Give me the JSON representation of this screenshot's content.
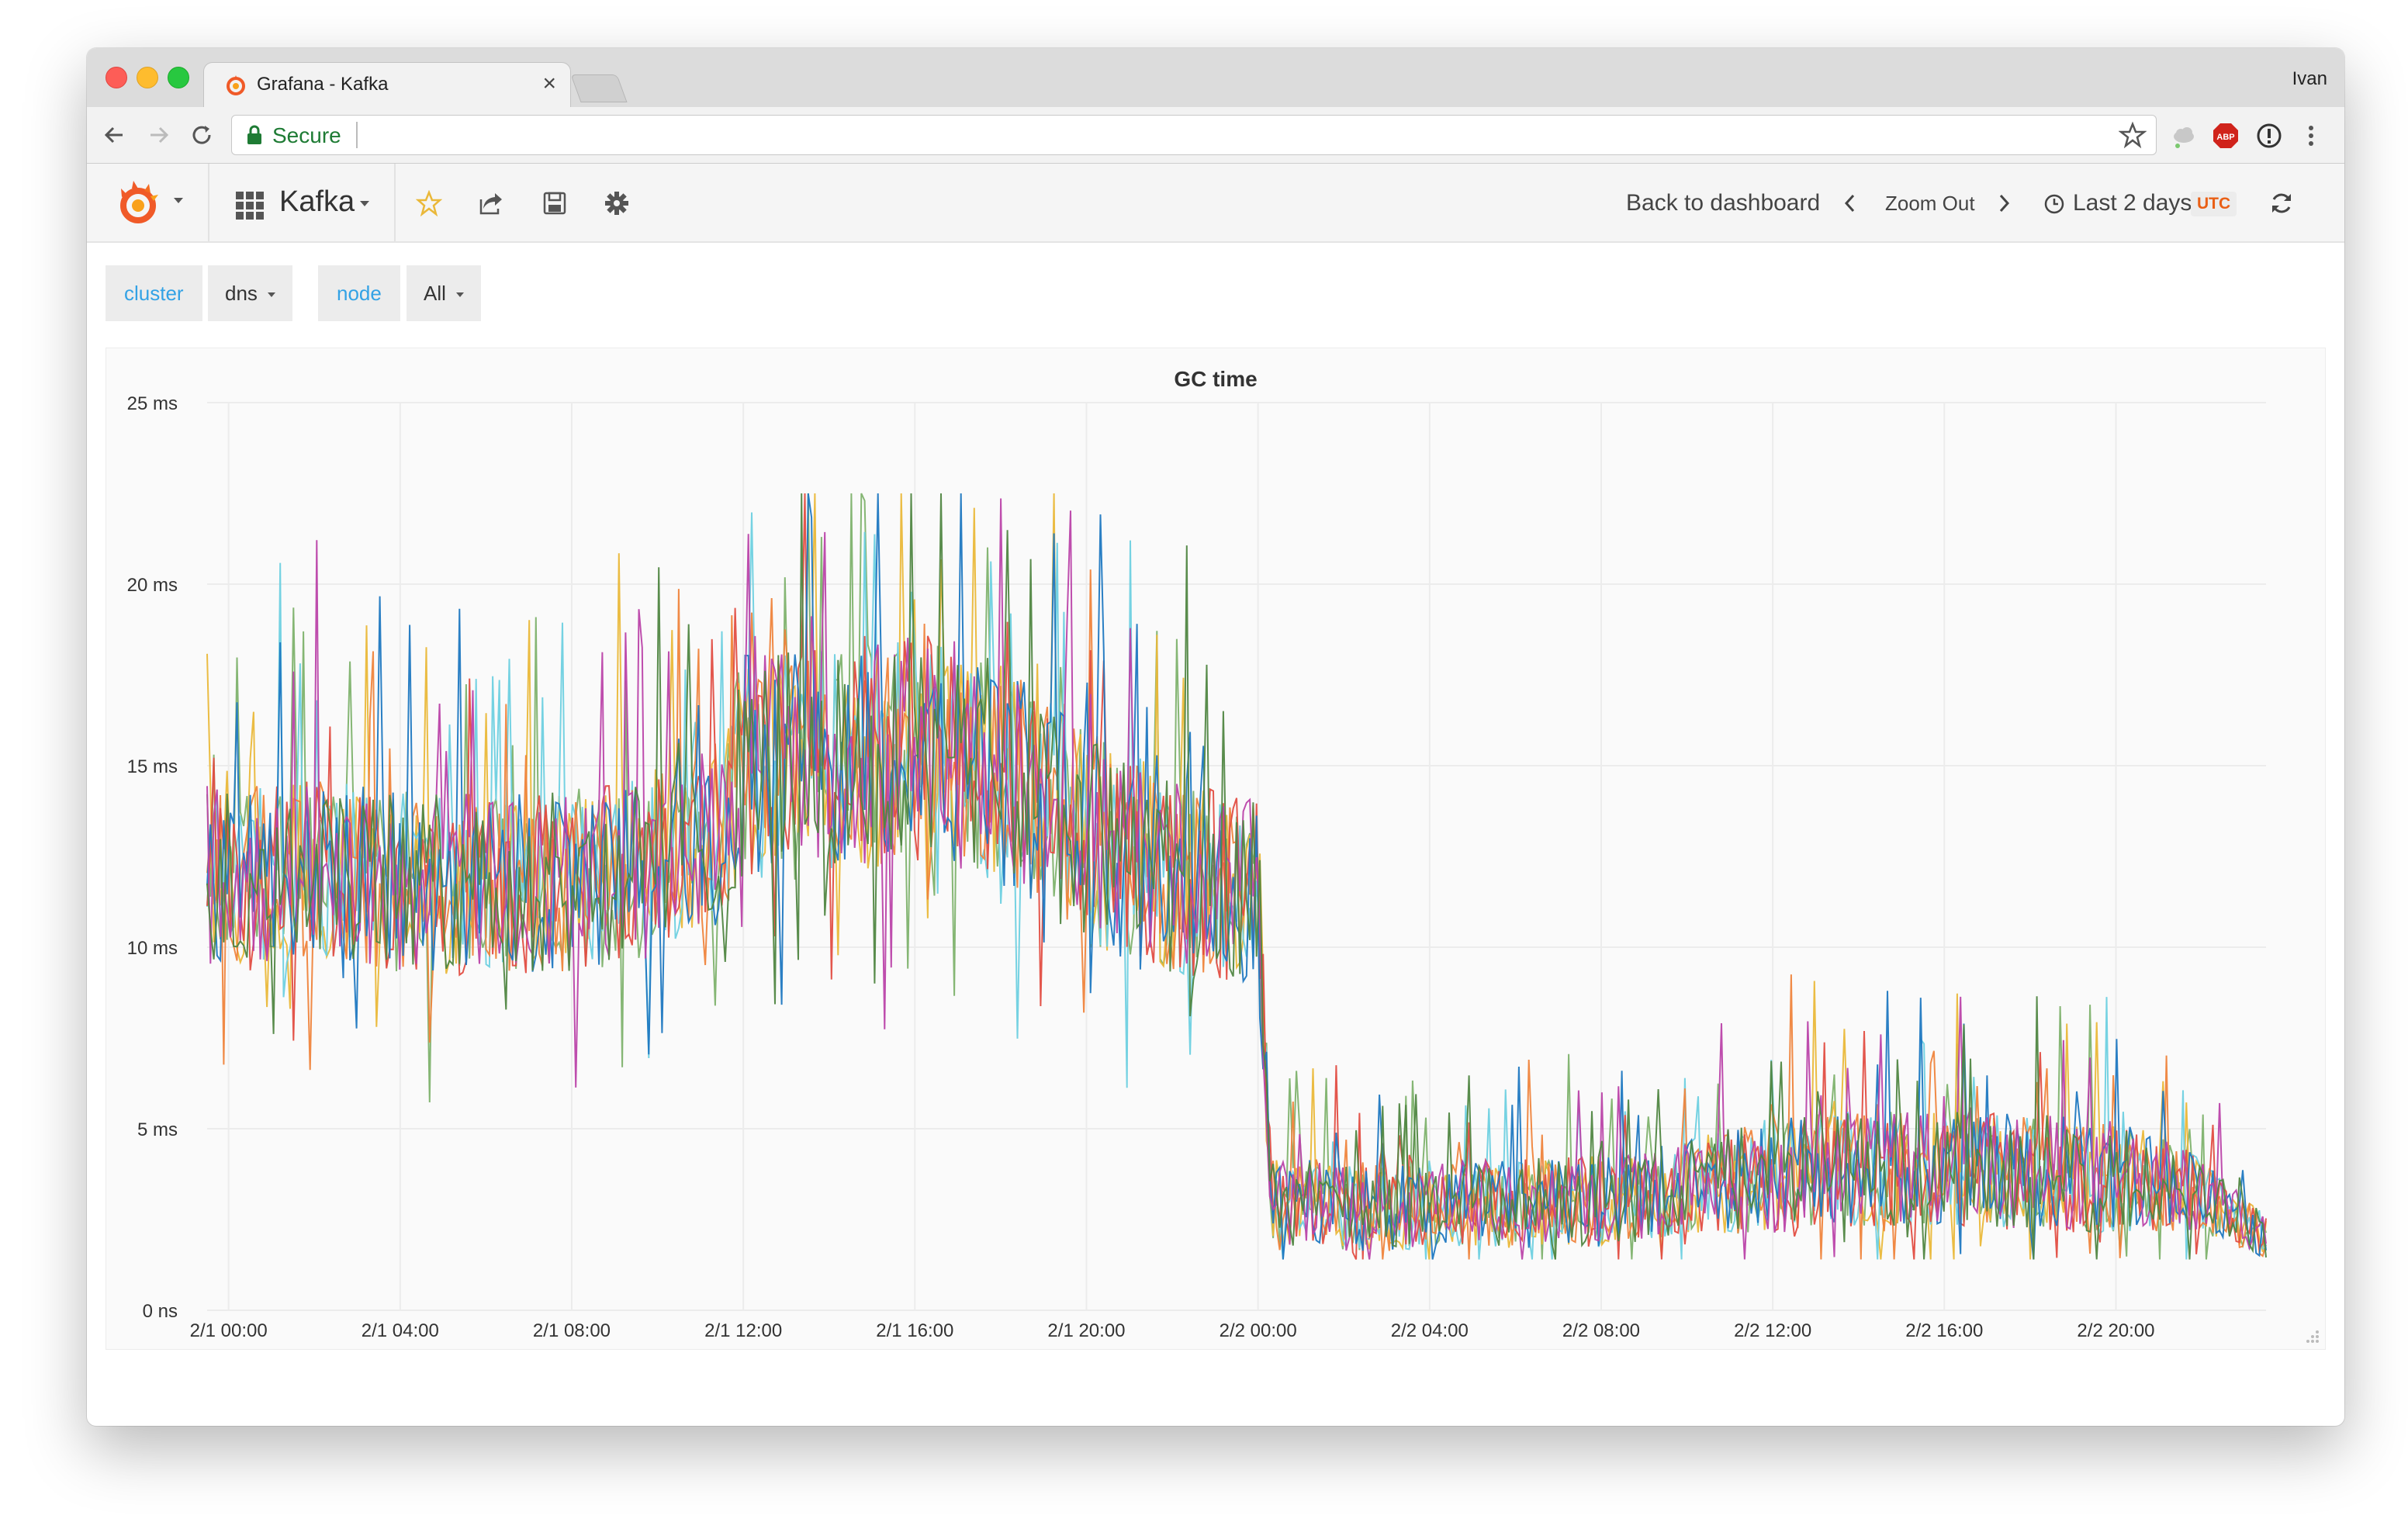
{
  "browser": {
    "tab_title": "Grafana - Kafka",
    "tab_close": "×",
    "profile_name": "Ivan",
    "secure_label": "Secure",
    "ext_adblock": "ABP"
  },
  "nav": {
    "dashboard_title": "Kafka",
    "back_to_dashboard": "Back to dashboard",
    "zoom_out": "Zoom Out",
    "time_range": "Last 2 days",
    "timezone": "UTC"
  },
  "variables": [
    {
      "label": "cluster",
      "value": "dns"
    },
    {
      "label": "node",
      "value": "All"
    }
  ],
  "panel": {
    "title": "GC time"
  },
  "chart_data": {
    "type": "line",
    "title": "GC time",
    "xlabel": "",
    "ylabel": "",
    "y_ticks": [
      "0 ns",
      "5 ms",
      "10 ms",
      "15 ms",
      "20 ms",
      "25 ms"
    ],
    "x_ticks": [
      "2/1 00:00",
      "2/1 04:00",
      "2/1 08:00",
      "2/1 12:00",
      "2/1 16:00",
      "2/1 20:00",
      "2/2 00:00",
      "2/2 04:00",
      "2/2 08:00",
      "2/2 12:00",
      "2/2 16:00",
      "2/2 20:00"
    ],
    "ylim": [
      0,
      25
    ],
    "xlim_hours": [
      -0.5,
      47.5
    ],
    "grid": true,
    "legend": "none",
    "series_count": 8,
    "series_colors": [
      "#7eb26d",
      "#eab839",
      "#6ed0e0",
      "#ef843c",
      "#e24d42",
      "#1f78c1",
      "#ba43a9",
      "#508642"
    ],
    "baseline_ms": [
      [
        -0.5,
        12
      ],
      [
        2,
        12.2
      ],
      [
        4,
        11.8
      ],
      [
        6,
        11.7
      ],
      [
        8,
        11.8
      ],
      [
        10,
        12.2
      ],
      [
        11.5,
        13.5
      ],
      [
        12,
        15
      ],
      [
        14,
        15
      ],
      [
        16,
        15.5
      ],
      [
        18,
        14.8
      ],
      [
        20,
        13
      ],
      [
        22,
        12
      ],
      [
        24,
        11.5
      ],
      [
        24.3,
        3
      ],
      [
        26,
        2.8
      ],
      [
        28,
        2.9
      ],
      [
        30,
        2.9
      ],
      [
        32,
        3.0
      ],
      [
        34,
        3.4
      ],
      [
        36,
        3.7
      ],
      [
        38,
        3.9
      ],
      [
        40,
        3.9
      ],
      [
        42,
        3.8
      ],
      [
        44,
        3.7
      ],
      [
        46,
        3.2
      ],
      [
        47.5,
        2.0
      ]
    ],
    "noise_amplitude_ms": [
      [
        -0.5,
        2.5
      ],
      [
        11.5,
        2.5
      ],
      [
        12,
        3.2
      ],
      [
        20,
        3.0
      ],
      [
        24,
        2.5
      ],
      [
        24.3,
        1.2
      ],
      [
        34,
        1.3
      ],
      [
        36,
        1.6
      ],
      [
        44,
        1.6
      ],
      [
        47.5,
        0.6
      ]
    ],
    "peak_ms": 22.5
  }
}
